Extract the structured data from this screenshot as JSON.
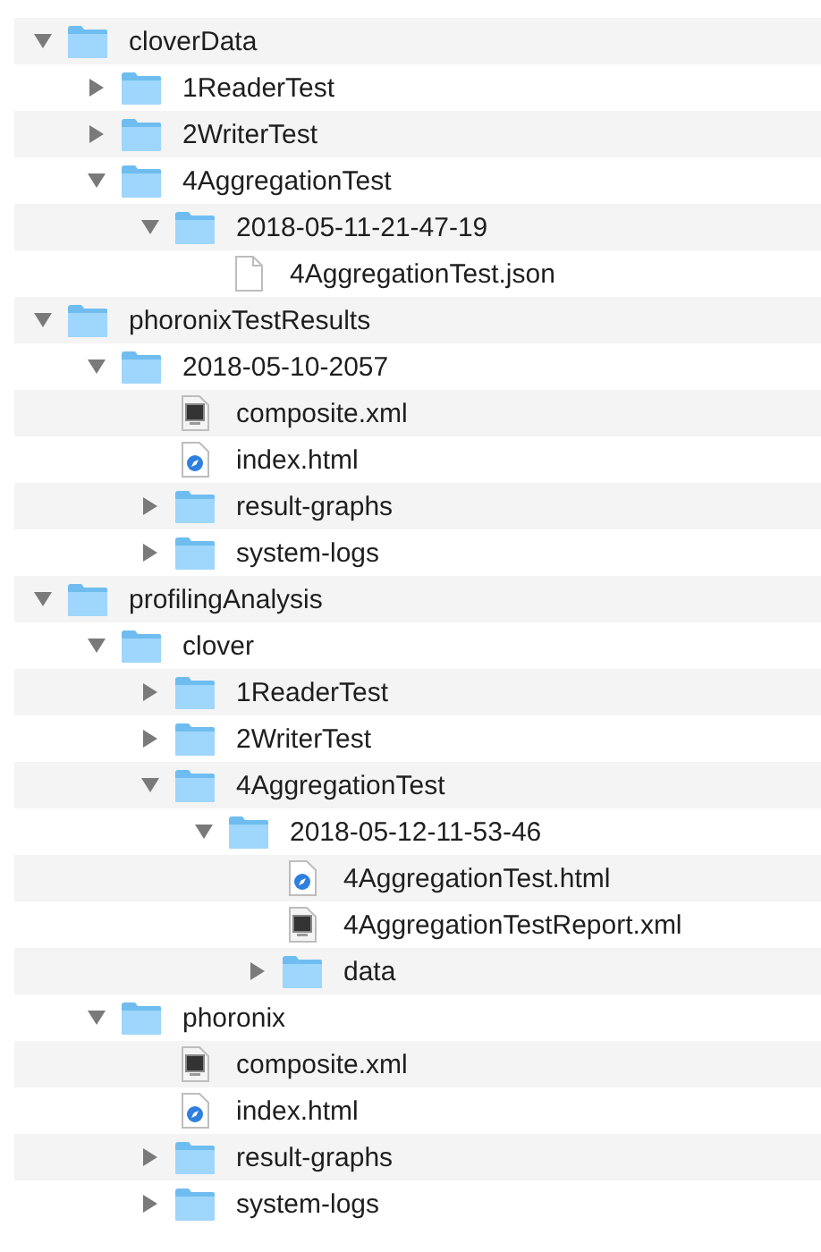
{
  "tree": [
    {
      "name": "cloverData",
      "kind": "folder",
      "expanded": true,
      "children": [
        {
          "name": "1ReaderTest",
          "kind": "folder",
          "expanded": false
        },
        {
          "name": "2WriterTest",
          "kind": "folder",
          "expanded": false
        },
        {
          "name": "4AggregationTest",
          "kind": "folder",
          "expanded": true,
          "children": [
            {
              "name": "2018-05-11-21-47-19",
              "kind": "folder",
              "expanded": true,
              "children": [
                {
                  "name": "4AggregationTest.json",
                  "kind": "plain"
                }
              ]
            }
          ]
        }
      ]
    },
    {
      "name": "phoronixTestResults",
      "kind": "folder",
      "expanded": true,
      "children": [
        {
          "name": "2018-05-10-2057",
          "kind": "folder",
          "expanded": true,
          "children": [
            {
              "name": "composite.xml",
              "kind": "xml"
            },
            {
              "name": "index.html",
              "kind": "html"
            },
            {
              "name": "result-graphs",
              "kind": "folder",
              "expanded": false
            },
            {
              "name": "system-logs",
              "kind": "folder",
              "expanded": false
            }
          ]
        }
      ]
    },
    {
      "name": "profilingAnalysis",
      "kind": "folder",
      "expanded": true,
      "children": [
        {
          "name": "clover",
          "kind": "folder",
          "expanded": true,
          "children": [
            {
              "name": "1ReaderTest",
              "kind": "folder",
              "expanded": false
            },
            {
              "name": "2WriterTest",
              "kind": "folder",
              "expanded": false
            },
            {
              "name": "4AggregationTest",
              "kind": "folder",
              "expanded": true,
              "children": [
                {
                  "name": "2018-05-12-11-53-46",
                  "kind": "folder",
                  "expanded": true,
                  "children": [
                    {
                      "name": "4AggregationTest.html",
                      "kind": "html"
                    },
                    {
                      "name": "4AggregationTestReport.xml",
                      "kind": "xml"
                    },
                    {
                      "name": "data",
                      "kind": "folder",
                      "expanded": false
                    }
                  ]
                }
              ]
            }
          ]
        },
        {
          "name": "phoronix",
          "kind": "folder",
          "expanded": true,
          "children": [
            {
              "name": "composite.xml",
              "kind": "xml"
            },
            {
              "name": "index.html",
              "kind": "html"
            },
            {
              "name": "result-graphs",
              "kind": "folder",
              "expanded": false
            },
            {
              "name": "system-logs",
              "kind": "folder",
              "expanded": false
            }
          ]
        }
      ]
    }
  ]
}
